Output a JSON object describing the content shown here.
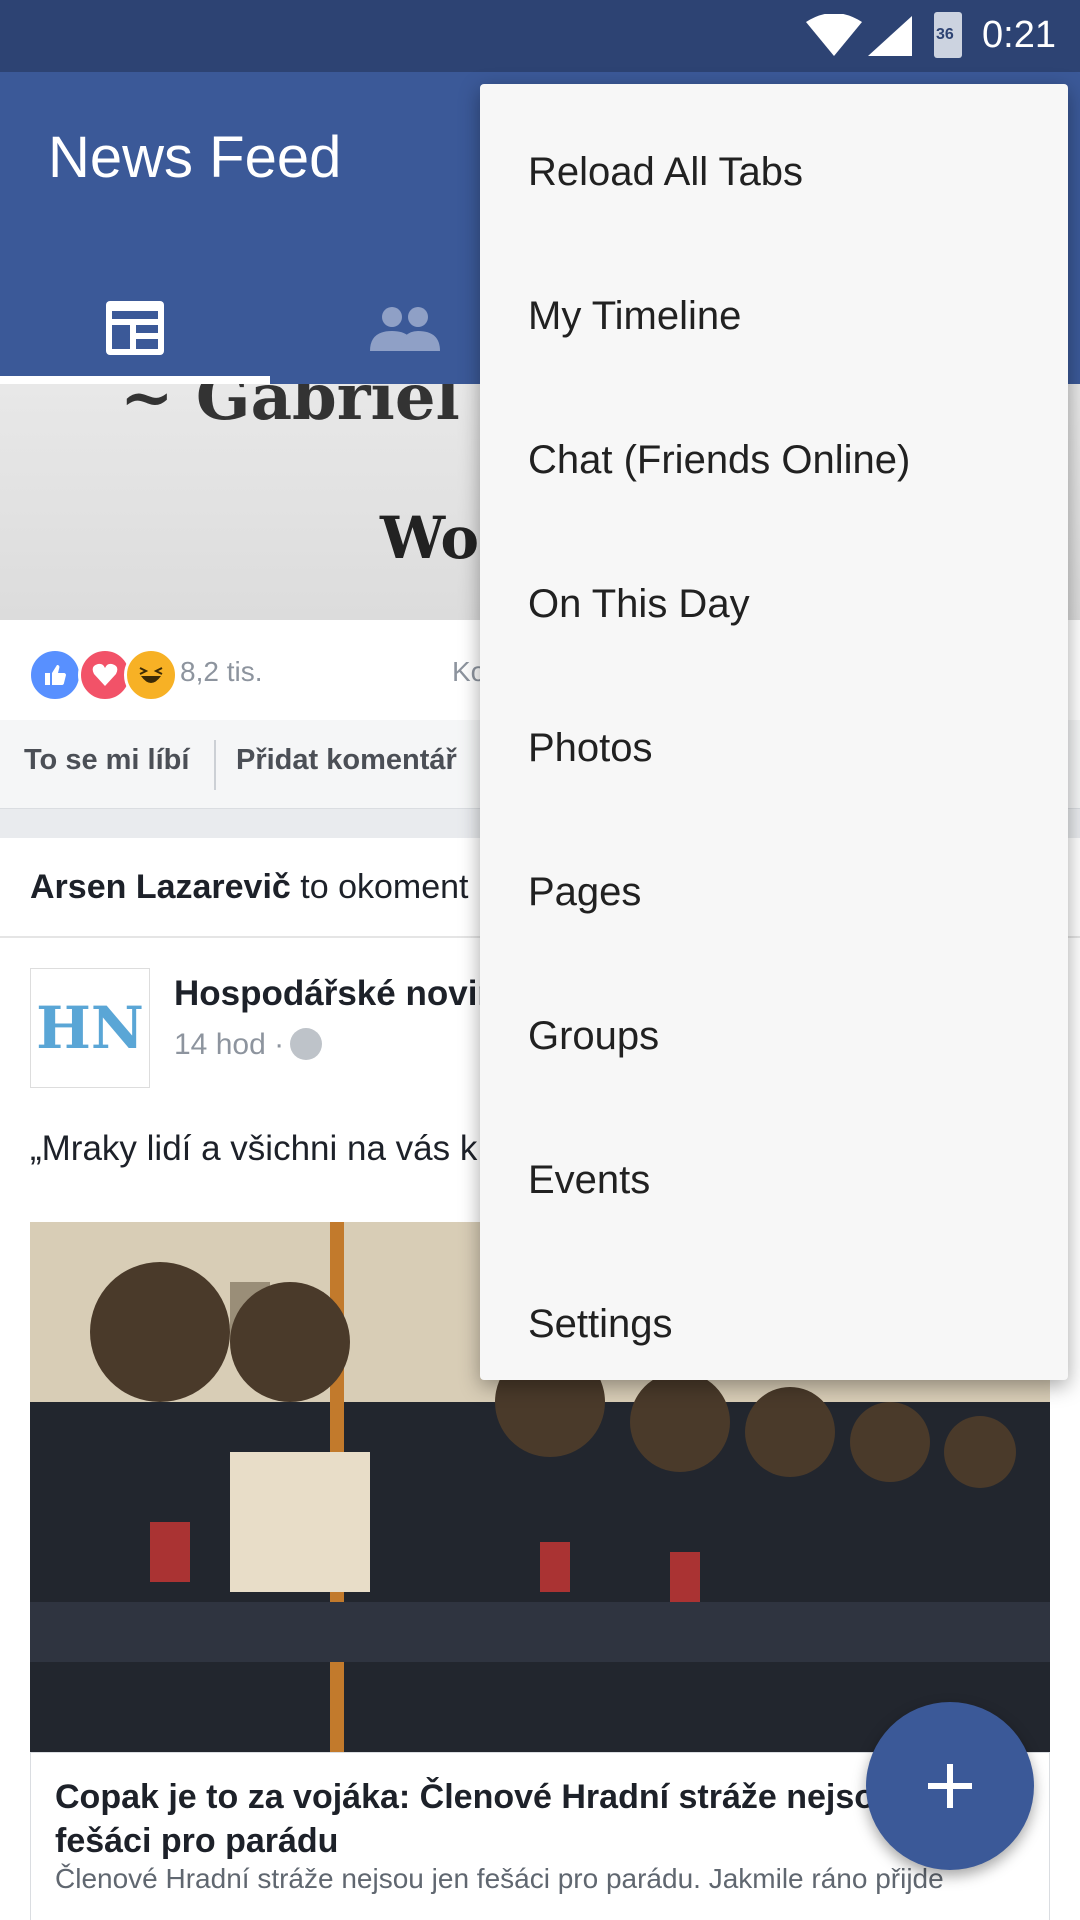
{
  "status_bar": {
    "time": "0:21",
    "battery_level": "36"
  },
  "app_bar": {
    "title": "News Feed"
  },
  "tabs": [
    {
      "name": "news-feed-tab",
      "icon": "news-feed-icon"
    },
    {
      "name": "friends-tab",
      "icon": "friends-icon"
    }
  ],
  "quote_card": {
    "image_text_line1": "~ Gabriel G",
    "image_text_line2": "Wor",
    "reaction_count": "8,2 tis.",
    "comments_label": "Ko",
    "like_button": "To se mi líbí",
    "comment_button": "Přidat komentář"
  },
  "post": {
    "notice_user": "Arsen Lazarevič",
    "notice_text": "to okoment",
    "page_logo_text": "HN",
    "page_name": "Hospodářské novin",
    "time": "14 hod ·",
    "text": "„Mraky lidí a všichni na vás k jsem byl vyklepanej jak start",
    "link_title": "Copak je to za vojáka: Členové Hradní stráže nejsou fešáci pro parádu",
    "link_description": "Členové Hradní stráže nejsou jen fešáci pro parádu. Jakmile ráno přijde"
  },
  "menu": {
    "items": [
      {
        "label": "Reload All Tabs"
      },
      {
        "label": "My Timeline"
      },
      {
        "label": "Chat (Friends Online)"
      },
      {
        "label": "On This Day"
      },
      {
        "label": "Photos"
      },
      {
        "label": "Pages"
      },
      {
        "label": "Groups"
      },
      {
        "label": "Events"
      },
      {
        "label": "Settings"
      }
    ]
  },
  "fab": {
    "icon": "plus-icon"
  },
  "colors": {
    "brand": "#3b5998",
    "status_bar": "#2d4373",
    "menu_bg": "#f7f7f7"
  }
}
